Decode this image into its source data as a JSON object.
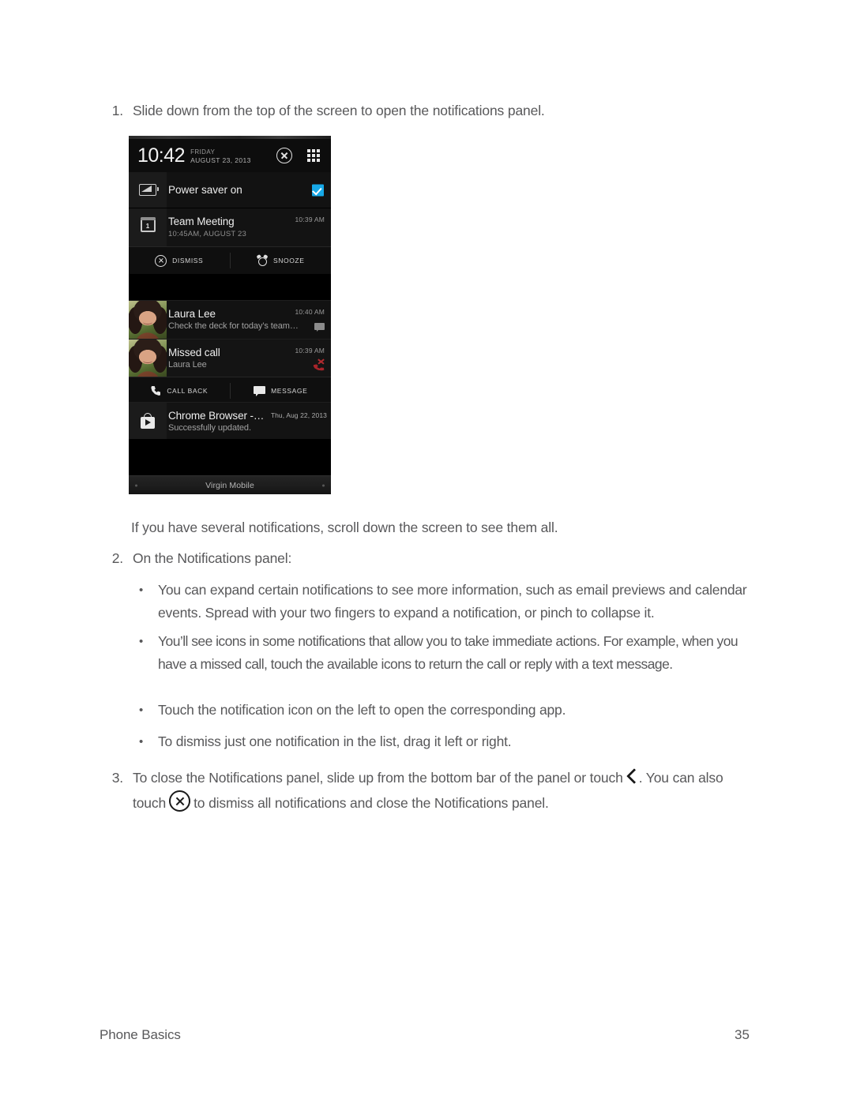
{
  "document": {
    "footer_section": "Phone Basics",
    "page_number": "35"
  },
  "steps": {
    "step1_num": "1.",
    "step1_text": "Slide down from the top of the screen to open the notifications panel.",
    "note_after_image": "If you have several notifications, scroll down the screen to see them all.",
    "step2_num": "2.",
    "step2_text": "On the Notifications panel:",
    "step3_num": "3.",
    "step3_part1": "To close the Notifications panel, slide up from the bottom bar of the panel or touch",
    "step3_part2": ". You can",
    "step3_part3": "also touch",
    "step3_part4": "to dismiss all notifications and close the Notifications panel."
  },
  "bullets": [
    {
      "line1": "You can expand certain notifications to see more information, such as email previews and",
      "line2": "calendar events. Spread with your two fingers to expand a notification, or pinch to collapse it."
    },
    {
      "line1": "You’ll see icons in some notifications that allow you to take immediate actions. For example,",
      "line2": "when you have a missed call, touch the available icons to return the call or reply with a text",
      "line3": "message."
    },
    {
      "line1": "Touch the notification icon on the left to open the corresponding app."
    },
    {
      "line1": "To dismiss just one notification in the list, drag it left or right."
    }
  ],
  "phone": {
    "statusbar": {
      "time": "10:42",
      "day": "FRIDAY",
      "date": "AUGUST 23, 2013",
      "clear_all_icon": "x-circle-icon",
      "quick_settings_icon": "grid-icon"
    },
    "notifications": [
      {
        "id": "power-saver",
        "icon": "power-saver-icon",
        "title": "Power saver on",
        "toggle": "checked",
        "toggle_color": "#17a9e8"
      },
      {
        "id": "team-meeting",
        "icon": "calendar-icon",
        "icon_day": "1",
        "title": "Team Meeting",
        "subtitle": "10:45AM, AUGUST 23",
        "time": "10:39 AM",
        "actions": [
          {
            "label": "DISMISS",
            "icon": "x-circle-icon"
          },
          {
            "label": "SNOOZE",
            "icon": "alarm-clock-icon"
          }
        ]
      },
      {
        "id": "laura-lee-message",
        "icon": "avatar-photo",
        "title": "Laura Lee",
        "subtitle": "Check the deck for today’s team…",
        "time": "10:40 AM",
        "badge_icon": "message-bubble-icon"
      },
      {
        "id": "missed-call",
        "icon": "avatar-photo",
        "title": "Missed call",
        "subtitle": "Laura Lee",
        "time": "10:39 AM",
        "badge_icon": "missed-call-icon",
        "badge_color": "#a8242a",
        "actions": [
          {
            "label": "CALL BACK",
            "icon": "phone-icon"
          },
          {
            "label": "MESSAGE",
            "icon": "message-bubble-icon"
          }
        ]
      },
      {
        "id": "chrome-browser-update",
        "icon": "play-store-icon",
        "title": "Chrome Browser -…",
        "subtitle": "Successfully updated.",
        "time": "Thu, Aug 22, 2013"
      }
    ],
    "carrier_bar": {
      "label": "Virgin Mobile"
    }
  }
}
